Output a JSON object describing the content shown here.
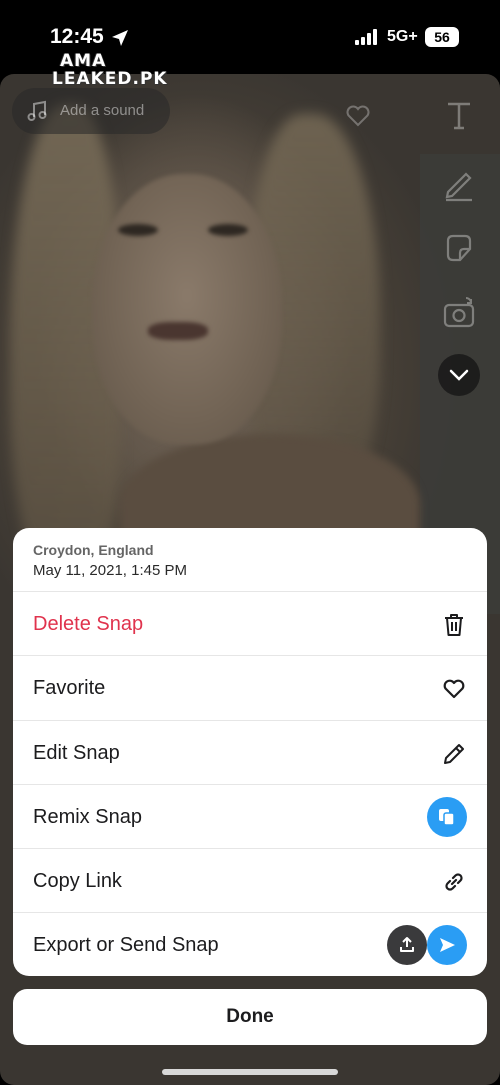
{
  "status_bar": {
    "time": "12:45",
    "network": "5G+",
    "battery": "56"
  },
  "watermark": {
    "line1": "AMA",
    "line2": "LEAKED.PK"
  },
  "snap": {
    "add_sound_label": "Add a sound",
    "tools": [
      "text-tool-icon",
      "pen-icon",
      "sticker-icon",
      "camera-flip-icon",
      "chevron-down-icon"
    ]
  },
  "sheet": {
    "location": "Croydon, England",
    "datetime": "May 11, 2021, 1:45 PM",
    "items": [
      {
        "label": "Delete Snap",
        "icon": "trash-icon",
        "danger": true
      },
      {
        "label": "Favorite",
        "icon": "heart-icon"
      },
      {
        "label": "Edit Snap",
        "icon": "pencil-icon"
      },
      {
        "label": "Remix Snap",
        "icon": "remix-icon"
      },
      {
        "label": "Copy Link",
        "icon": "link-icon"
      },
      {
        "label": "Export or Send Snap",
        "icon": "export-icon"
      }
    ]
  },
  "done_label": "Done",
  "colors": {
    "danger": "#e0334d",
    "accent_blue": "#2a9df4"
  }
}
